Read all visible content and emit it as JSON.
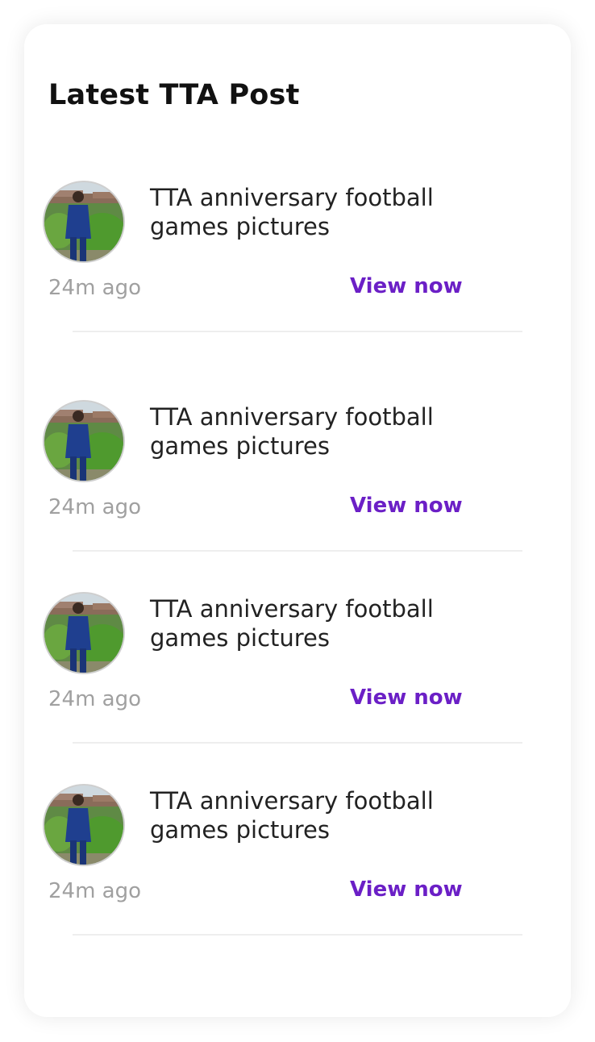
{
  "card": {
    "title": "Latest TTA Post"
  },
  "posts": [
    {
      "title": "TTA anniversary football games pictures",
      "time": "24m ago",
      "action": "View now"
    },
    {
      "title": "TTA anniversary football games pictures",
      "time": "24m ago",
      "action": "View now"
    },
    {
      "title": "TTA anniversary football games pictures",
      "time": "24m ago",
      "action": "View now"
    },
    {
      "title": "TTA anniversary football games pictures",
      "time": "24m ago",
      "action": "View now"
    }
  ],
  "colors": {
    "accent": "#6b1fc6",
    "time_text": "#a0a0a0",
    "title_text": "#222222",
    "divider": "#eeeeee"
  }
}
